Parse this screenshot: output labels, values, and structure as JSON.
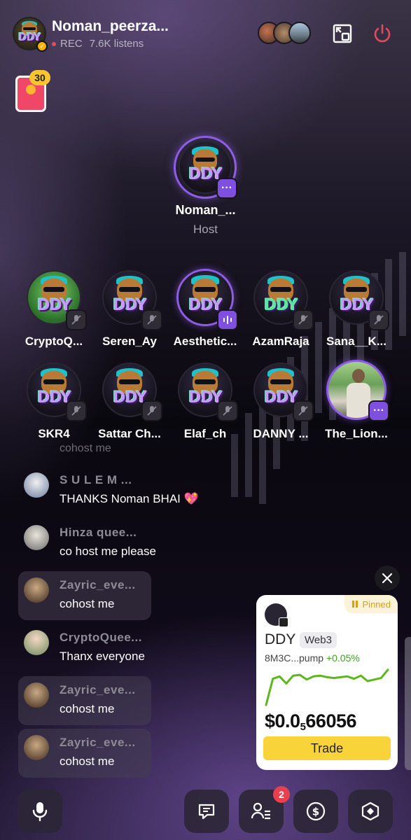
{
  "header": {
    "room_title": "Noman_peerza...",
    "rec_label": "REC",
    "listens": "7.6K listens"
  },
  "gift": {
    "count": "30"
  },
  "host": {
    "name": "Noman_...",
    "role": "Host"
  },
  "speakers_row1": [
    {
      "name": "CryptoQ..."
    },
    {
      "name": "Seren_Ay"
    },
    {
      "name": "Aesthetic..."
    },
    {
      "name": "AzamRaja"
    },
    {
      "name": "Sana__K..."
    }
  ],
  "speakers_row2": [
    {
      "name": "SKR4"
    },
    {
      "name": "Sattar Ch..."
    },
    {
      "name": "Elaf_ch"
    },
    {
      "name": "DANNY ..."
    },
    {
      "name": "The_Lion..."
    }
  ],
  "chat": {
    "faded_text": "cohost me",
    "messages": [
      {
        "user": "S U L E M ...",
        "text": "THANKS Noman BHAI 💖"
      },
      {
        "user": "Hinza quee...",
        "text": "co host me please"
      },
      {
        "user": "Zayric_eve...",
        "text": "cohost me"
      },
      {
        "user": "CryptoQuee...",
        "text": "Thanx everyone"
      },
      {
        "user": "Zayric_eve...",
        "text": "cohost me"
      },
      {
        "user": "Zayric_eve...",
        "text": "cohost me"
      }
    ]
  },
  "token": {
    "pinned_label": "Pinned",
    "name": "DDY",
    "tag": "Web3",
    "address": "8M3C...pump",
    "change": "+0.05%",
    "price_prefix": "$0.0",
    "price_sub": "5",
    "price_suffix": "66056",
    "trade_label": "Trade",
    "sparkline": [
      0.05,
      0.72,
      0.78,
      0.6,
      0.8,
      0.82,
      0.7,
      0.78,
      0.8,
      0.76,
      0.74,
      0.76,
      0.78,
      0.72,
      0.8,
      0.66,
      0.7,
      0.74,
      0.95
    ]
  },
  "bottom_bar": {
    "participants_badge": "2"
  },
  "colors": {
    "accent": "#8e5de5",
    "trade": "#f8d43a",
    "positive": "#3da11e",
    "danger": "#e24b5c"
  },
  "icons": [
    "mic-icon",
    "chat-icon",
    "participants-icon",
    "dollar-icon",
    "hexagon-icon",
    "minimize-window-icon",
    "power-icon",
    "close-icon",
    "mic-muted-icon",
    "more-icon",
    "voice-wave-icon"
  ]
}
